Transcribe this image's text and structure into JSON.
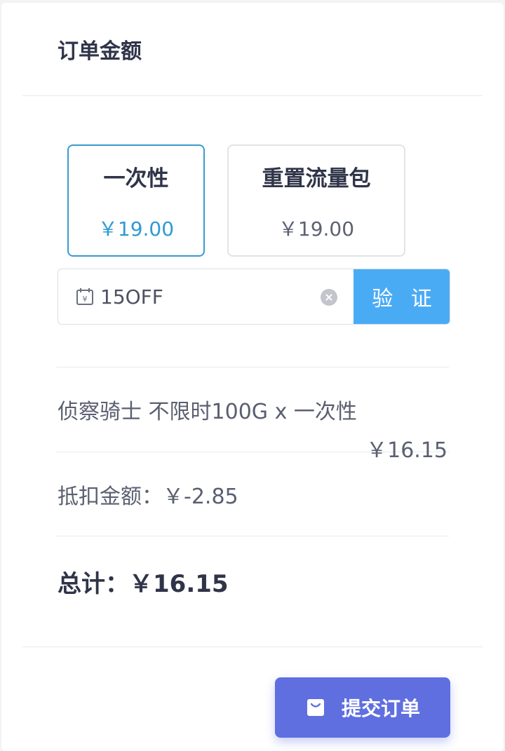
{
  "header": {
    "title": "订单金额"
  },
  "plans": [
    {
      "name": "一次性",
      "price": "￥19.00",
      "selected": true
    },
    {
      "name": "重置流量包",
      "price": "￥19.00",
      "selected": false
    }
  ],
  "coupon": {
    "icon": "calendar-yen-icon",
    "value": "15OFF",
    "clear_icon": "clear-icon",
    "verify_label": "验 证"
  },
  "summary": {
    "line_item": "侦察骑士 不限时100G x 一次性",
    "line_price": "￥16.15",
    "discount": "抵扣金额：￥-2.85",
    "total": "总计：￥16.15"
  },
  "submit": {
    "icon": "shopping-bag-icon",
    "label": "提交订单"
  },
  "colors": {
    "accent_blue": "#2f9ad4",
    "verify_button": "#4aabf5",
    "submit_button": "#5f6fe0",
    "heading_text": "#2f3448"
  }
}
